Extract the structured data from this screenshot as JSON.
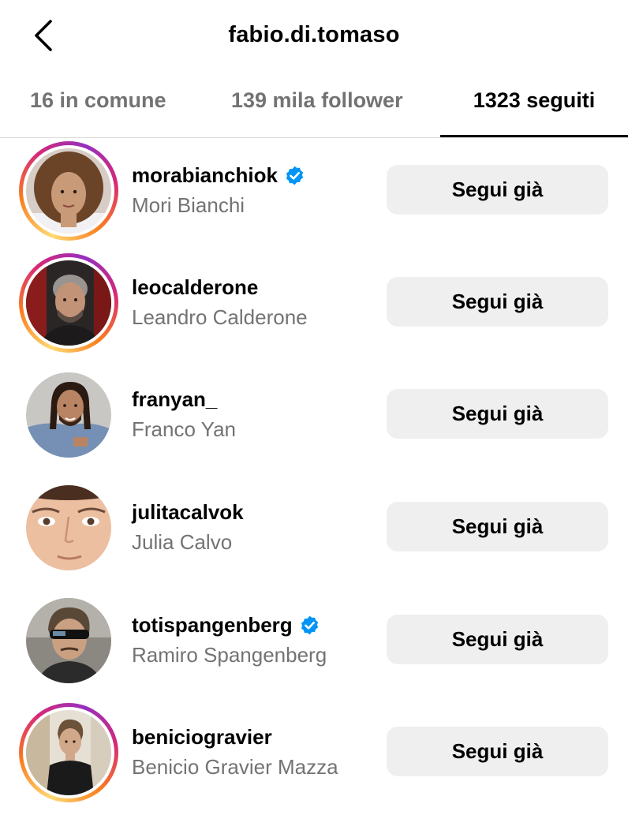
{
  "header": {
    "title": "fabio.di.tomaso"
  },
  "tabs": [
    {
      "label": "16 in comune",
      "active": false
    },
    {
      "label": "139 mila follower",
      "active": false
    },
    {
      "label": "1323 seguiti",
      "active": true
    }
  ],
  "users": [
    {
      "username": "morabianchiok",
      "full_name": "Mori Bianchi",
      "verified": true,
      "story_ring": true,
      "button": "Segui già"
    },
    {
      "username": "leocalderone",
      "full_name": "Leandro Calderone",
      "verified": false,
      "story_ring": true,
      "button": "Segui già"
    },
    {
      "username": "franyan_",
      "full_name": "Franco Yan",
      "verified": false,
      "story_ring": false,
      "button": "Segui già"
    },
    {
      "username": "julitacalvok",
      "full_name": "Julia Calvo",
      "verified": false,
      "story_ring": false,
      "button": "Segui già"
    },
    {
      "username": "totispangenberg",
      "full_name": "Ramiro Spangenberg",
      "verified": true,
      "story_ring": false,
      "button": "Segui già"
    },
    {
      "username": "beniciogravier",
      "full_name": "Benicio Gravier Mazza",
      "verified": false,
      "story_ring": true,
      "button": "Segui già"
    }
  ],
  "colors": {
    "verified_badge": "#0095f6",
    "button_bg": "#efefef",
    "secondary_text": "#737373"
  }
}
